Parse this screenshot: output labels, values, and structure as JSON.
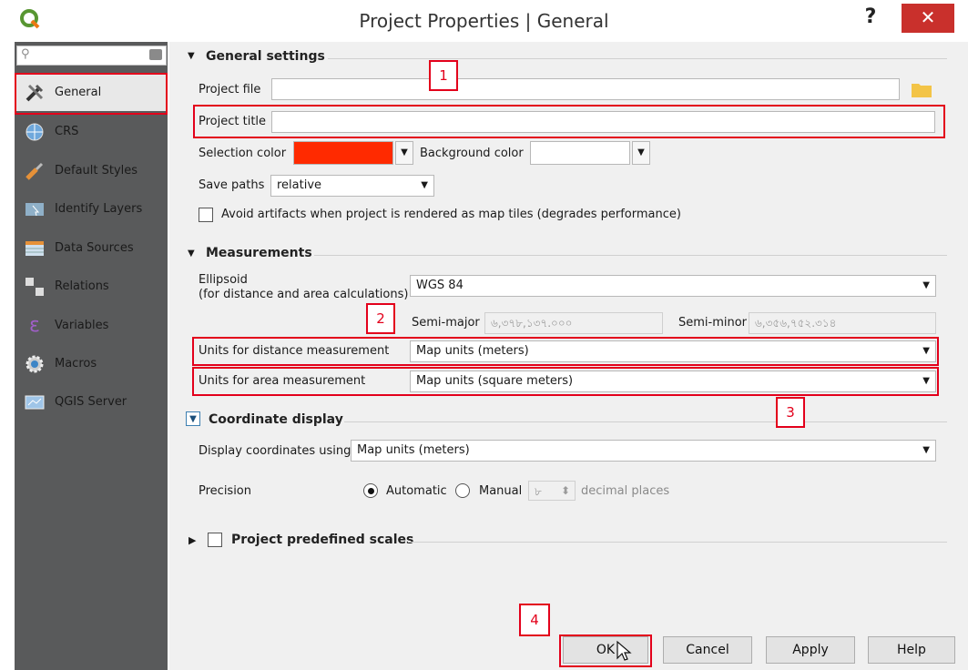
{
  "window": {
    "title": "Project Properties | General",
    "help_label": "?",
    "close_label": "✕",
    "logo_icon": "qgis-logo-icon"
  },
  "sidebar": {
    "search_placeholder": "",
    "items": [
      {
        "label": "General",
        "icon": "tools-icon",
        "active": true
      },
      {
        "label": "CRS",
        "icon": "globe-icon"
      },
      {
        "label": "Default Styles",
        "icon": "brush-icon"
      },
      {
        "label": "Identify Layers",
        "icon": "identify-icon"
      },
      {
        "label": "Data Sources",
        "icon": "table-icon"
      },
      {
        "label": "Relations",
        "icon": "relations-icon"
      },
      {
        "label": "Variables",
        "icon": "epsilon-icon"
      },
      {
        "label": "Macros",
        "icon": "gear-icon"
      },
      {
        "label": "QGIS Server",
        "icon": "server-icon"
      }
    ]
  },
  "general": {
    "heading": "General settings",
    "project_file_label": "Project file",
    "project_file_value": "",
    "project_title_label": "Project title",
    "project_title_value": "",
    "selection_color_label": "Selection color",
    "selection_color": "#ff2a00",
    "background_color_label": "Background color",
    "background_color": "#ffffff",
    "save_paths_label": "Save paths",
    "save_paths_value": "relative",
    "avoid_artifacts_label": "Avoid artifacts when project is rendered as map tiles (degrades performance)"
  },
  "measurements": {
    "heading": "Measurements",
    "ellipsoid_label": "Ellipsoid",
    "ellipsoid_sublabel": "(for distance and area calculations)",
    "ellipsoid_value": "WGS 84",
    "semi_major_label": "Semi-major",
    "semi_major_value": "৬,৩৭৮,১৩৭.০০০",
    "semi_minor_label": "Semi-minor",
    "semi_minor_value": "৬,৩৫৬,৭৫২.৩১৪",
    "distance_label": "Units for distance measurement",
    "distance_value": "Map units (meters)",
    "area_label": "Units for area measurement",
    "area_value": "Map units (square meters)"
  },
  "coordinate": {
    "heading": "Coordinate display",
    "display_label": "Display coordinates using",
    "display_value": "Map units (meters)",
    "precision_label": "Precision",
    "automatic_label": "Automatic",
    "manual_label": "Manual",
    "manual_value": "৮",
    "decimal_label": "decimal places"
  },
  "scales": {
    "heading": "Project predefined scales"
  },
  "buttons": {
    "ok": "OK",
    "cancel": "Cancel",
    "apply": "Apply",
    "help": "Help"
  },
  "annotations": {
    "b1": "1",
    "b2": "2",
    "b3": "3",
    "b4": "4"
  }
}
